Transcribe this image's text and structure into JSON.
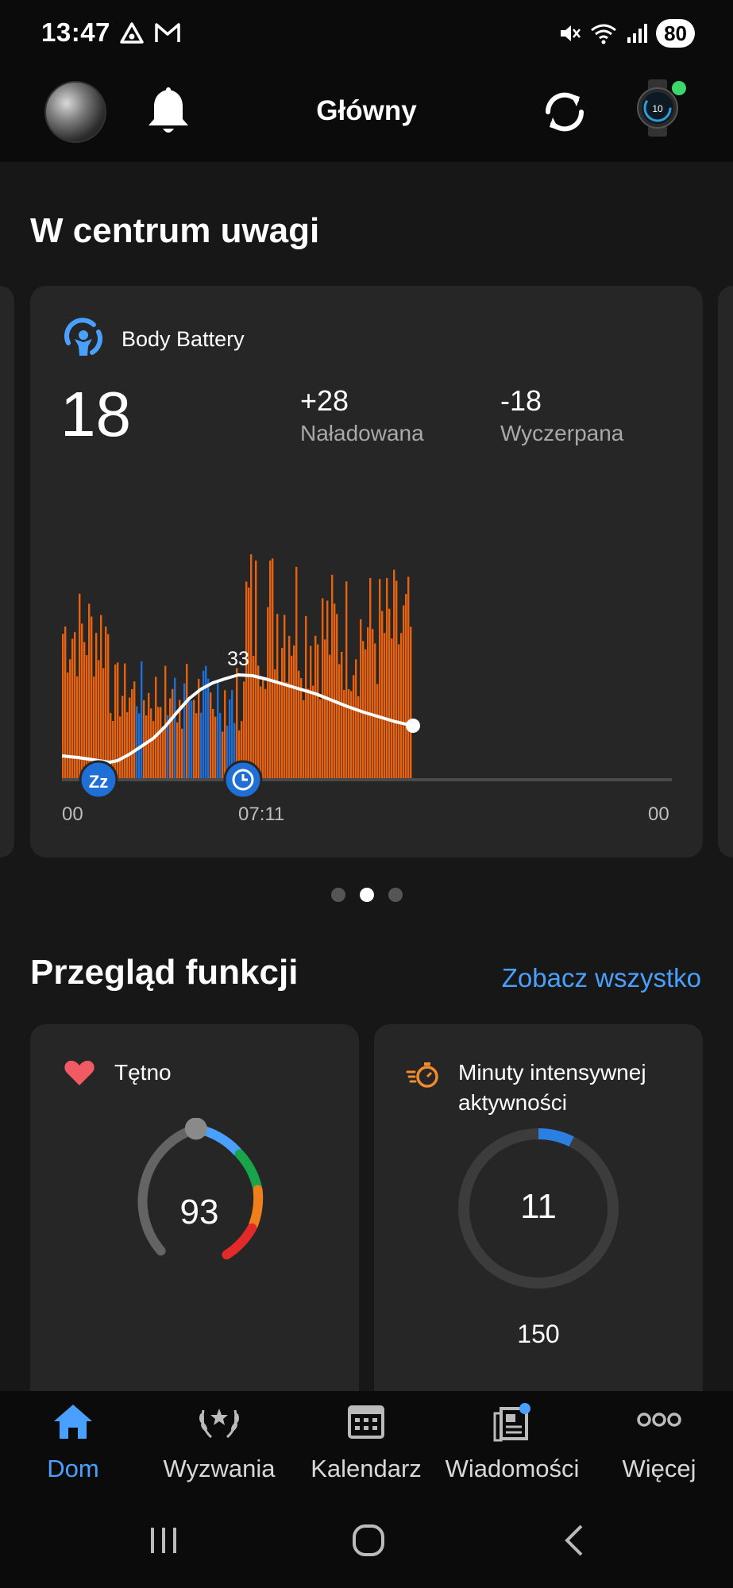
{
  "status_bar": {
    "time": "13:47",
    "battery": "80",
    "icons": [
      "triangle-app-icon",
      "gmail-icon",
      "mute-icon",
      "wifi-icon",
      "signal-icon"
    ]
  },
  "header": {
    "title": "Główny",
    "icons": [
      "avatar",
      "bell-icon",
      "sync-icon",
      "watch-icon"
    ],
    "watch_status_color": "#3ed66b"
  },
  "spotlight": {
    "section_title": "W centrum uwagi",
    "card": {
      "title": "Body Battery",
      "value": "18",
      "charged_value": "+28",
      "charged_label": "Naładowana",
      "drained_value": "-18",
      "drained_label": "Wyczerpana",
      "peak_label": "33",
      "axis_start": "00",
      "axis_mid": "07:11",
      "axis_end": "00",
      "colors": {
        "stress": "#e8620e",
        "rest": "#1f6fd6",
        "line": "#ffffff"
      }
    },
    "pager": {
      "count": 3,
      "active": 1
    }
  },
  "features": {
    "section_title": "Przegląd funkcji",
    "see_all": "Zobacz wszystko",
    "heart_rate": {
      "title": "Tętno",
      "value": "93",
      "icon": "heart-icon",
      "icon_color": "#f05a63"
    },
    "intensity": {
      "title_line1": "Minuty intensywnej",
      "title_line2": "aktywności",
      "value": "11",
      "goal": "150",
      "icon": "stopwatch-icon",
      "icon_color": "#f08c2e",
      "progress_fraction": 0.073
    }
  },
  "bottom_nav": {
    "items": [
      {
        "label": "Dom",
        "icon": "home-icon",
        "active": true
      },
      {
        "label": "Wyzwania",
        "icon": "laurel-icon",
        "active": false
      },
      {
        "label": "Kalendarz",
        "icon": "calendar-icon",
        "active": false
      },
      {
        "label": "Wiadomości",
        "icon": "news-icon",
        "active": false
      },
      {
        "label": "Więcej",
        "icon": "more-icon",
        "active": false
      }
    ],
    "accent": "#4aa0ff"
  },
  "system_nav": [
    "recents-button",
    "home-button",
    "back-button"
  ]
}
